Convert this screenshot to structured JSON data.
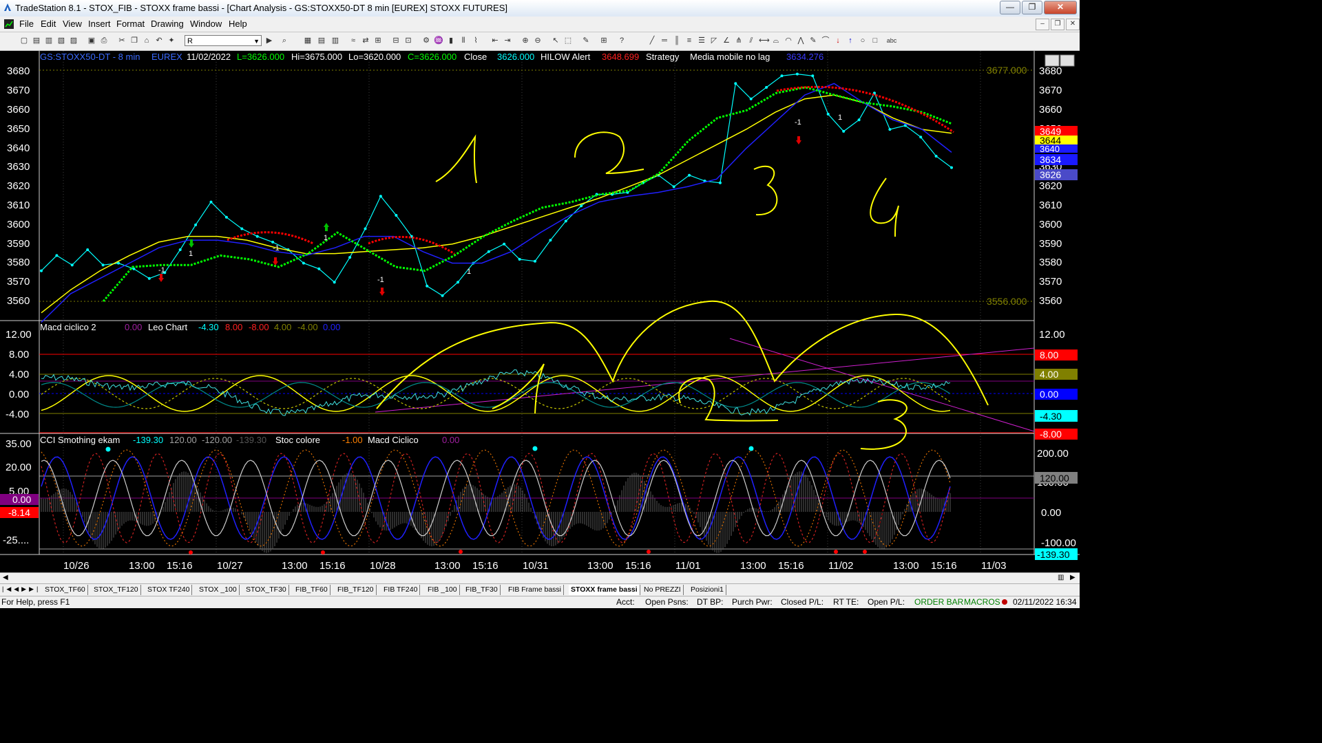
{
  "window": {
    "title": "TradeStation 8.1 - STOX_FIB - STOXX frame bassi - [Chart Analysis - GS:STOXX50-DT  8 min  [EUREX] STOXX FUTURES]",
    "minimize": "—",
    "restore": "❐",
    "close": "✕"
  },
  "menu": {
    "items": [
      "File",
      "Edit",
      "View",
      "Insert",
      "Format",
      "Drawing",
      "Window",
      "Help"
    ],
    "mdi_buttons": [
      "–",
      "❐",
      "✕"
    ]
  },
  "toolbar": {
    "symbol_value": "R",
    "annotation": "abc"
  },
  "header": {
    "symbol": "GS:STOXX50-DT - 8 min",
    "exchange": "EUREX",
    "date": "11/02/2022",
    "last": "L=3626.000",
    "hi": "Hi=3675.000",
    "lo": "Lo=3620.000",
    "close_val": "C=3626.000",
    "close_label": "Close",
    "close_value": "3626.000",
    "hilow_label": "HILOW Alert",
    "hilow_value": "3648.699",
    "strategy_label": "Strategy",
    "media_label": "Media mobile no lag",
    "media_value": "3634.276"
  },
  "price_axis": {
    "ticks": [
      "3680",
      "3670",
      "3660",
      "3650",
      "3640",
      "3630",
      "3620",
      "3610",
      "3600",
      "3590",
      "3580",
      "3570",
      "3560"
    ],
    "marker_hi": "3677.000",
    "marker_lo": "3556.000",
    "right_ticks": [
      "3680",
      "3670",
      "3660",
      "3650",
      "3640",
      "3630",
      "3620",
      "3610",
      "3600",
      "3590",
      "3580",
      "3570",
      "3560"
    ],
    "badges": [
      {
        "text": "3649",
        "color": "#ff0000"
      },
      {
        "text": "3644",
        "color": "#ffff00"
      },
      {
        "text": "3640",
        "color": "#1a1aff"
      },
      {
        "text": "3634",
        "color": "#1a1aff"
      },
      {
        "text": "3626",
        "color": "#4a4ac8"
      }
    ]
  },
  "macd_panel": {
    "name": "Macd ciclico 2",
    "v1": "0.00",
    "chart_name": "Leo Chart",
    "v2": "-4.30",
    "v3": "8.00",
    "v4": "-8.00",
    "v5": "4.00",
    "v6": "-4.00",
    "v7": "0.00",
    "ticks": [
      "12.00",
      "8.00",
      "4.00",
      "0.00",
      "-4.00"
    ],
    "right_ticks": [
      "12.00"
    ],
    "badges": [
      {
        "text": "8.00",
        "color": "#ff0000"
      },
      {
        "text": "4.00",
        "color": "#808000"
      },
      {
        "text": "0.00",
        "color": "#0000ff"
      },
      {
        "text": "-4.30",
        "color": "#00ffff"
      },
      {
        "text": "-8.00",
        "color": "#ff0000"
      }
    ]
  },
  "cci_panel": {
    "name": "CCI Smothing ekam",
    "v1": "-139.30",
    "v2": "120.00",
    "v3": "-120.00",
    "v4": "-139.30",
    "stoc_label": "Stoc colore",
    "stoc_value": "-1.00",
    "macd_label": "Macd Ciclico",
    "macd_value": "0.00",
    "ticks": [
      "35.00",
      "20.00",
      "5.00",
      "-25...."
    ],
    "left_badges": [
      {
        "text": "0.00",
        "color": "#800080"
      },
      {
        "text": "-8.14",
        "color": "#ff0000"
      }
    ],
    "right_ticks": [
      "200.00",
      "100.00",
      "0.00",
      "-100.00"
    ],
    "badges": [
      {
        "text": "120.00",
        "color": "#808080"
      },
      {
        "text": "-139.30",
        "color": "#00ffff"
      }
    ]
  },
  "time_axis": {
    "labels": [
      "10/26",
      "13:00",
      "15:16",
      "10/27",
      "13:00",
      "15:16",
      "10/28",
      "13:00",
      "15:16",
      "10/31",
      "13:00",
      "15:16",
      "11/01",
      "13:00",
      "15:16",
      "11/02",
      "13:00",
      "15:16",
      "11/03"
    ]
  },
  "annotations": [
    "1",
    "2",
    "3",
    "4",
    "1",
    "2",
    "3"
  ],
  "signals": [
    "1",
    "-1",
    "1",
    "-1",
    "1",
    "-1",
    "1",
    "-1"
  ],
  "tabs": [
    "STOX_TF60",
    "STOX_TF120",
    "STOX TF240",
    "STOX _100",
    "STOX_TF30",
    "FIB_TF60",
    "FIB_TF120",
    "FIB TF240",
    "FIB _100",
    "FIB_TF30",
    "FIB Frame bassi",
    "STOXX frame bassi",
    "No PREZZI",
    "Posizioni1"
  ],
  "active_tab": "STOXX frame bassi",
  "status": {
    "help": "For Help, press F1",
    "acct": "Acct:",
    "open_psns": "Open Psns:",
    "dt_bp": "DT BP:",
    "purch_pwr": "Purch Pwr:",
    "closed_pl": "Closed P/L:",
    "rt_te": "RT TE:",
    "open_pl": "Open P/L:",
    "order_bar": "ORDER BAR",
    "macros": "MACROS",
    "datetime": "02/11/2022 16:34"
  },
  "chart_data": {
    "type": "line",
    "title": "GS:STOXX50-DT - 8 min",
    "ylim": [
      3553,
      3683
    ],
    "x_labels": [
      "10/26",
      "13:00",
      "15:16",
      "10/27",
      "13:00",
      "15:16",
      "10/28",
      "13:00",
      "15:16",
      "10/31",
      "13:00",
      "15:16",
      "11/01",
      "13:00",
      "15:16",
      "11/02",
      "13:00",
      "15:16",
      "11/03"
    ],
    "series": [
      {
        "values": [
          3572,
          3580,
          3575,
          3583,
          3575,
          3576,
          3573,
          3568,
          3571,
          3583,
          3596,
          3608,
          3600,
          3594,
          3590,
          3587,
          3583,
          3576,
          3573,
          3566,
          3579,
          3594,
          3611,
          3601,
          3590,
          3564,
          3559,
          3566,
          3576,
          3582,
          3586,
          3578,
          3577,
          3588,
          3598,
          3606,
          3612,
          3612,
          3613,
          3618,
          3622,
          3616,
          3622,
          3619,
          3618,
          3670,
          3662,
          3668,
          3674,
          3675,
          3674,
          3654,
          3645,
          3651,
          3665,
          3646,
          3648,
          3642,
          3632,
          3626
        ],
        "color": "#00ffff"
      },
      {
        "values": [
          3550,
          3562,
          3572,
          3580,
          3587,
          3590,
          3590,
          3588,
          3584,
          3581,
          3581,
          3582,
          3583,
          3584,
          3586,
          3590,
          3595,
          3600,
          3605,
          3610,
          3616,
          3622,
          3630,
          3638,
          3646,
          3655,
          3662,
          3664,
          3660,
          3652,
          3646,
          3644
        ],
        "color": "#ffff00"
      },
      {
        "values": [
          3545,
          3560,
          3568,
          3576,
          3584,
          3588,
          3588,
          3586,
          3582,
          3580,
          3584,
          3590,
          3590,
          3582,
          3576,
          3576,
          3582,
          3592,
          3601,
          3608,
          3611,
          3613,
          3616,
          3620,
          3636,
          3650,
          3664,
          3670,
          3660,
          3651,
          3646,
          3634
        ],
        "color": "#2020ff"
      },
      {
        "values": [
          3556,
          3574,
          3575,
          3575,
          3580,
          3578,
          3574,
          3581,
          3592,
          3583,
          3574,
          3572,
          3580,
          3590,
          3598,
          3605,
          3608,
          3612,
          3614,
          3623,
          3640,
          3652,
          3656,
          3665,
          3668,
          3664,
          3660,
          3658,
          3655,
          3649
        ],
        "color": "#00ff00"
      }
    ]
  }
}
